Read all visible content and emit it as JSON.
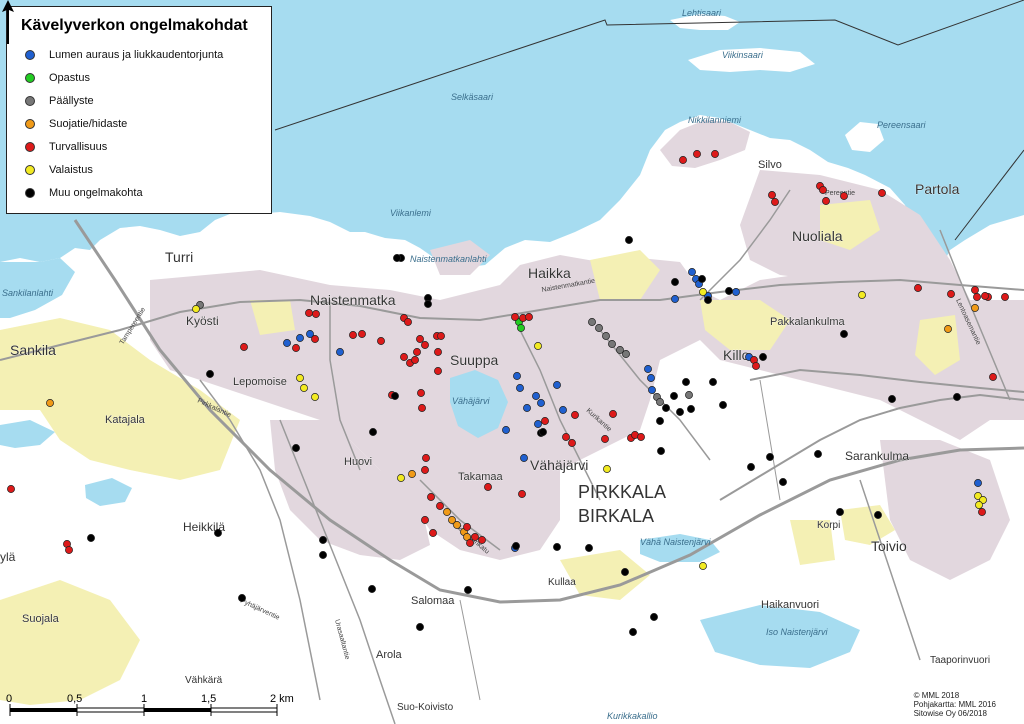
{
  "title": "Kävelyverkon ongelmakohdat",
  "legend": [
    {
      "label": "Lumen auraus ja liukkaudentorjunta",
      "color": "#2060d0"
    },
    {
      "label": "Opastus",
      "color": "#22cc22"
    },
    {
      "label": "Päällyste",
      "color": "#777777"
    },
    {
      "label": "Suojatie/hidaste",
      "color": "#f09a18"
    },
    {
      "label": "Turvallisuus",
      "color": "#dd1a1a"
    },
    {
      "label": "Valaistus",
      "color": "#f2ea22"
    },
    {
      "label": "Muu ongelmakohta",
      "color": "#000000"
    }
  ],
  "colors": {
    "water": "#a6dcf0",
    "land": "#ffffff",
    "urban": "#e2d7de",
    "field": "#f4f0b4",
    "road": "#9a9a9a"
  },
  "place_labels": [
    {
      "text": "Turri",
      "size": 14
    },
    {
      "text": "Sankila",
      "size": 14
    },
    {
      "text": "Naistenmatka",
      "size": 14
    },
    {
      "text": "Kyösti",
      "size": 12
    },
    {
      "text": "Haikka",
      "size": 14
    },
    {
      "text": "Nuoliala",
      "size": 14
    },
    {
      "text": "Partola",
      "size": 14
    },
    {
      "text": "Silvo",
      "size": 11
    },
    {
      "text": "Suuppa",
      "size": 14
    },
    {
      "text": "Killo",
      "size": 14
    },
    {
      "text": "Pakkalankulma",
      "size": 11
    },
    {
      "text": "Katajala",
      "size": 11
    },
    {
      "text": "Lepomoise",
      "size": 11
    },
    {
      "text": "Huovi",
      "size": 11
    },
    {
      "text": "Vähäjärvi",
      "size": 14
    },
    {
      "text": "PIRKKALA",
      "size": 18
    },
    {
      "text": "BIRKALA",
      "size": 18
    },
    {
      "text": "Takamaa",
      "size": 11
    },
    {
      "text": "Heikkilä",
      "size": 12
    },
    {
      "text": "ylä",
      "size": 12
    },
    {
      "text": "Sarankulma",
      "size": 12
    },
    {
      "text": "Korpi",
      "size": 10
    },
    {
      "text": "Toivio",
      "size": 14
    },
    {
      "text": "Salomaa",
      "size": 11
    },
    {
      "text": "Kullaa",
      "size": 10
    },
    {
      "text": "Haikanvuori",
      "size": 11
    },
    {
      "text": "Arola",
      "size": 11
    },
    {
      "text": "Suojala",
      "size": 11
    },
    {
      "text": "Vähkärä",
      "size": 10
    },
    {
      "text": "Suo-Koivisto",
      "size": 10
    },
    {
      "text": "Taaporinvuori",
      "size": 10
    }
  ],
  "water_labels": [
    {
      "text": "Lehtisaari"
    },
    {
      "text": "Viikinsaari"
    },
    {
      "text": "Selkäsaari"
    },
    {
      "text": "Nikkilanniemi"
    },
    {
      "text": "Pereensaari"
    },
    {
      "text": "Viikanlemi"
    },
    {
      "text": "Naistenmatkanlahti"
    },
    {
      "text": "Vähäjärvi"
    },
    {
      "text": "Vähä Naistenjärvi"
    },
    {
      "text": "Iso Naistenjärvi"
    },
    {
      "text": "Sankilanlahti"
    },
    {
      "text": "Kurikkakallio"
    }
  ],
  "road_labels": [
    {
      "text": "Naistenmatkantie"
    },
    {
      "text": "Pyhäjärventie"
    },
    {
      "text": "Tampereentie"
    },
    {
      "text": "Pirkkalantie"
    },
    {
      "text": "Kurkiloukunkatu"
    },
    {
      "text": "Urasaaltantie"
    },
    {
      "text": "Kurikantie"
    },
    {
      "text": "Pereentie"
    },
    {
      "text": "Lentoasemantie"
    }
  ],
  "scale": {
    "ticks": [
      "0",
      "0,5",
      "1",
      "1,5",
      "2 km"
    ]
  },
  "credits": [
    "© MML 2018",
    "Pohjakartta: MML 2016",
    "Sitowise Oy 06/2018"
  ],
  "problem_points": {
    "snow": [
      [
        287,
        343
      ],
      [
        300,
        338
      ],
      [
        310,
        334
      ],
      [
        340,
        352
      ],
      [
        517,
        376
      ],
      [
        520,
        388
      ],
      [
        527,
        408
      ],
      [
        536,
        396
      ],
      [
        541,
        403
      ],
      [
        557,
        385
      ],
      [
        563,
        410
      ],
      [
        538,
        424
      ],
      [
        506,
        430
      ],
      [
        515,
        548
      ],
      [
        524,
        458
      ],
      [
        648,
        369
      ],
      [
        651,
        378
      ],
      [
        652,
        390
      ],
      [
        692,
        272
      ],
      [
        696,
        279
      ],
      [
        699,
        284
      ],
      [
        675,
        299
      ],
      [
        708,
        296
      ],
      [
        736,
        292
      ],
      [
        749,
        357
      ],
      [
        978,
        483
      ]
    ],
    "guidance": [
      [
        519,
        322
      ],
      [
        521,
        328
      ]
    ],
    "paving": [
      [
        200,
        305
      ],
      [
        592,
        322
      ],
      [
        599,
        328
      ],
      [
        606,
        336
      ],
      [
        612,
        344
      ],
      [
        620,
        350
      ],
      [
        626,
        354
      ],
      [
        657,
        397
      ],
      [
        660,
        402
      ],
      [
        689,
        395
      ]
    ],
    "crosswalk": [
      [
        50,
        403
      ],
      [
        412,
        474
      ],
      [
        447,
        512
      ],
      [
        452,
        520
      ],
      [
        457,
        525
      ],
      [
        464,
        532
      ],
      [
        467,
        537
      ],
      [
        975,
        308
      ],
      [
        948,
        329
      ]
    ],
    "safety": [
      [
        11,
        489
      ],
      [
        67,
        544
      ],
      [
        69,
        550
      ],
      [
        244,
        347
      ],
      [
        296,
        348
      ],
      [
        309,
        313
      ],
      [
        316,
        314
      ],
      [
        315,
        339
      ],
      [
        353,
        335
      ],
      [
        362,
        334
      ],
      [
        381,
        341
      ],
      [
        404,
        318
      ],
      [
        408,
        322
      ],
      [
        420,
        339
      ],
      [
        417,
        352
      ],
      [
        404,
        357
      ],
      [
        410,
        363
      ],
      [
        415,
        360
      ],
      [
        437,
        336
      ],
      [
        441,
        336
      ],
      [
        425,
        345
      ],
      [
        438,
        352
      ],
      [
        438,
        371
      ],
      [
        421,
        393
      ],
      [
        422,
        408
      ],
      [
        392,
        395
      ],
      [
        426,
        458
      ],
      [
        425,
        470
      ],
      [
        431,
        497
      ],
      [
        440,
        506
      ],
      [
        425,
        520
      ],
      [
        433,
        533
      ],
      [
        470,
        543
      ],
      [
        475,
        537
      ],
      [
        482,
        540
      ],
      [
        467,
        527
      ],
      [
        488,
        487
      ],
      [
        522,
        494
      ],
      [
        515,
        317
      ],
      [
        523,
        318
      ],
      [
        529,
        317
      ],
      [
        545,
        421
      ],
      [
        575,
        415
      ],
      [
        566,
        437
      ],
      [
        572,
        443
      ],
      [
        605,
        439
      ],
      [
        613,
        414
      ],
      [
        631,
        438
      ],
      [
        635,
        435
      ],
      [
        641,
        437
      ],
      [
        683,
        160
      ],
      [
        697,
        154
      ],
      [
        715,
        154
      ],
      [
        754,
        360
      ],
      [
        756,
        366
      ],
      [
        775,
        202
      ],
      [
        772,
        195
      ],
      [
        820,
        186
      ],
      [
        823,
        190
      ],
      [
        826,
        201
      ],
      [
        844,
        196
      ],
      [
        882,
        193
      ],
      [
        918,
        288
      ],
      [
        951,
        294
      ],
      [
        975,
        290
      ],
      [
        977,
        297
      ],
      [
        988,
        297
      ],
      [
        985,
        296
      ],
      [
        993,
        377
      ],
      [
        982,
        512
      ],
      [
        1005,
        297
      ]
    ],
    "lighting": [
      [
        196,
        309
      ],
      [
        300,
        378
      ],
      [
        304,
        388
      ],
      [
        315,
        397
      ],
      [
        401,
        478
      ],
      [
        538,
        346
      ],
      [
        607,
        469
      ],
      [
        703,
        566
      ],
      [
        703,
        292
      ],
      [
        862,
        295
      ],
      [
        978,
        496
      ],
      [
        983,
        500
      ],
      [
        979,
        505
      ]
    ],
    "other": [
      [
        210,
        374
      ],
      [
        395,
        396
      ],
      [
        373,
        432
      ],
      [
        296,
        448
      ],
      [
        91,
        538
      ],
      [
        218,
        533
      ],
      [
        323,
        540
      ],
      [
        323,
        555
      ],
      [
        242,
        598
      ],
      [
        420,
        627
      ],
      [
        468,
        590
      ],
      [
        372,
        589
      ],
      [
        401,
        258
      ],
      [
        397,
        258
      ],
      [
        428,
        298
      ],
      [
        428,
        304
      ],
      [
        557,
        547
      ],
      [
        589,
        548
      ],
      [
        625,
        572
      ],
      [
        654,
        617
      ],
      [
        633,
        632
      ],
      [
        629,
        240
      ],
      [
        675,
        282
      ],
      [
        702,
        279
      ],
      [
        708,
        300
      ],
      [
        729,
        291
      ],
      [
        763,
        357
      ],
      [
        723,
        405
      ],
      [
        713,
        382
      ],
      [
        691,
        409
      ],
      [
        680,
        412
      ],
      [
        674,
        396
      ],
      [
        666,
        408
      ],
      [
        686,
        382
      ],
      [
        660,
        421
      ],
      [
        661,
        451
      ],
      [
        751,
        467
      ],
      [
        770,
        457
      ],
      [
        783,
        482
      ],
      [
        818,
        454
      ],
      [
        844,
        334
      ],
      [
        892,
        399
      ],
      [
        878,
        515
      ],
      [
        957,
        397
      ],
      [
        840,
        512
      ],
      [
        516,
        546
      ],
      [
        541,
        433
      ],
      [
        543,
        432
      ]
    ]
  }
}
